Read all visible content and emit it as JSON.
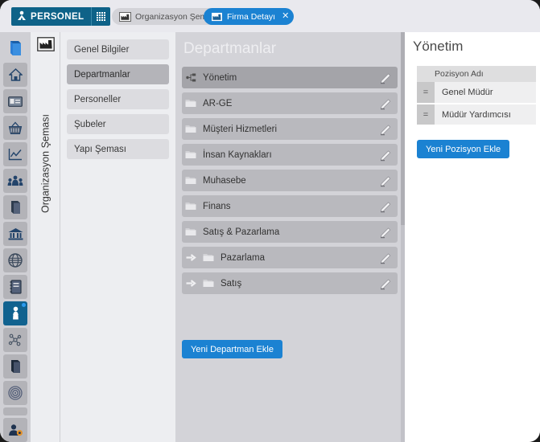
{
  "topbar": {
    "logo_text": "PERSONEL",
    "logo_icon": "person-icon",
    "grid_icon": "grid-apps-icon",
    "tabs": [
      {
        "label": "Organizasyon Şeması",
        "icon": "factory-icon",
        "active": false,
        "closable": false
      },
      {
        "label": "Firma Detayı",
        "icon": "factory-icon",
        "active": true,
        "closable": true,
        "close_glyph": "✕"
      }
    ]
  },
  "rail": {
    "items": [
      {
        "name": "book-icon",
        "active": false
      },
      {
        "name": "home-icon",
        "active": false
      },
      {
        "name": "id-card-icon",
        "active": false
      },
      {
        "name": "basket-icon",
        "active": false
      },
      {
        "name": "chart-line-icon",
        "active": false
      },
      {
        "name": "people-group-icon",
        "active": false
      },
      {
        "name": "book-closed-icon",
        "active": false
      },
      {
        "name": "bank-icon",
        "active": false
      },
      {
        "name": "globe-icon",
        "active": false
      },
      {
        "name": "notebook-icon",
        "active": false
      },
      {
        "name": "org-people-icon",
        "active": true,
        "badge": true
      },
      {
        "name": "network-nodes-icon",
        "active": false
      },
      {
        "name": "book-dark-icon",
        "active": false
      },
      {
        "name": "target-icon",
        "active": false
      },
      {
        "name": "spacer",
        "active": false
      },
      {
        "name": "user-settings-icon",
        "active": false
      }
    ],
    "logout_icon": "logout-arrow-icon"
  },
  "vertical_tab": {
    "label": "Organizasyon Şeması",
    "icon": "factory-icon"
  },
  "submenu": {
    "items": [
      {
        "label": "Genel Bilgiler",
        "selected": false
      },
      {
        "label": "Departmanlar",
        "selected": true
      },
      {
        "label": "Personeller",
        "selected": false
      },
      {
        "label": "Şubeler",
        "selected": false
      },
      {
        "label": "Yapı Şeması",
        "selected": false
      }
    ]
  },
  "main": {
    "title": "Departmanlar",
    "add_button": "Yeni Departman Ekle",
    "edit_icon": "pencil-edit-icon",
    "departments": [
      {
        "label": "Yönetim",
        "icon": "sitemap-icon",
        "selected": true,
        "child": false
      },
      {
        "label": "AR-GE",
        "icon": "folder-icon",
        "selected": false,
        "child": false
      },
      {
        "label": "Müşteri Hizmetleri",
        "icon": "folder-icon",
        "selected": false,
        "child": false
      },
      {
        "label": "İnsan Kaynakları",
        "icon": "folder-icon",
        "selected": false,
        "child": false
      },
      {
        "label": "Muhasebe",
        "icon": "folder-icon",
        "selected": false,
        "child": false
      },
      {
        "label": "Finans",
        "icon": "folder-icon",
        "selected": false,
        "child": false
      },
      {
        "label": "Satış & Pazarlama",
        "icon": "folder-icon",
        "selected": false,
        "child": false
      },
      {
        "label": "Pazarlama",
        "icon": "folder-icon",
        "selected": false,
        "child": true,
        "child_icon": "arrow-right-icon"
      },
      {
        "label": "Satış",
        "icon": "folder-icon",
        "selected": false,
        "child": true,
        "child_icon": "arrow-right-icon"
      }
    ]
  },
  "right": {
    "title": "Yönetim",
    "column_header": "Pozisyon Adı",
    "add_button": "Yeni Pozisyon Ekle",
    "drag_handle_glyph": "=",
    "positions": [
      {
        "name": "Genel Müdür"
      },
      {
        "name": "Müdür Yardımcısı"
      }
    ]
  },
  "colors": {
    "brand_dark": "#0e6288",
    "accent_blue": "#1b82d2",
    "panel_gray": "#d3d3d8",
    "row_gray": "#b9b9be",
    "row_selected": "#a4a4a9",
    "sidebar_bg": "#edeef1",
    "rail_bg": "#cfcfd4"
  }
}
